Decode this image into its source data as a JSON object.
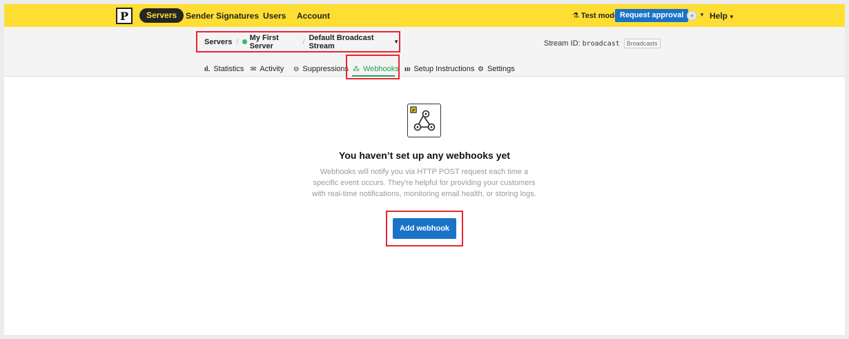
{
  "topbar": {
    "logo": "P",
    "nav": [
      "Servers",
      "Sender Signatures",
      "Users",
      "Account"
    ],
    "test_mode": "Test mode",
    "request_approval": "Request approval",
    "help": "Help"
  },
  "breadcrumb": {
    "root": "Servers",
    "server": "My First Server",
    "stream": "Default Broadcast Stream"
  },
  "stream_info": {
    "label": "Stream ID:",
    "id": "broadcast",
    "badge": "Broadcasts"
  },
  "tabs": [
    {
      "label": "Statistics",
      "icon": "bar-chart-icon"
    },
    {
      "label": "Activity",
      "icon": "envelope-icon"
    },
    {
      "label": "Suppressions",
      "icon": "minus-circle-icon"
    },
    {
      "label": "Webhooks",
      "icon": "webhook-icon",
      "active": true
    },
    {
      "label": "Setup Instructions",
      "icon": "book-icon"
    },
    {
      "label": "Settings",
      "icon": "gear-icon"
    }
  ],
  "empty_state": {
    "title": "You haven’t set up any webhooks yet",
    "description": "Webhooks will notify you via HTTP POST request each time a specific event occurs. They’re helpful for providing your customers with real-time notifications, monitoring email health, or storing logs.",
    "button": "Add webhook"
  },
  "colors": {
    "brand_yellow": "#ffde34",
    "primary_blue": "#1a73c8",
    "active_green": "#1f9e55",
    "highlight_red": "#e8242f"
  }
}
